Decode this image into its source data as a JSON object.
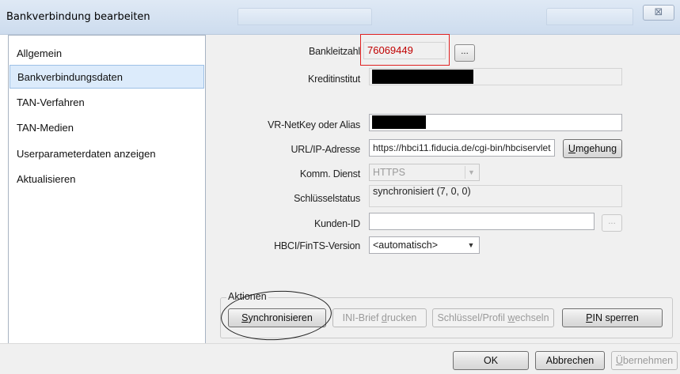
{
  "window": {
    "title": "Bankverbindung bearbeiten",
    "close_symbol": "⊠"
  },
  "sidebar": {
    "items": [
      {
        "label": "Allgemein"
      },
      {
        "label": "Bankverbindungsdaten"
      },
      {
        "label": "TAN-Verfahren"
      },
      {
        "label": "TAN-Medien"
      },
      {
        "label": "Userparameterdaten anzeigen"
      },
      {
        "label": "Aktualisieren"
      }
    ]
  },
  "form": {
    "blz": {
      "label": "Bankleitzahl",
      "value": "76069449",
      "button": "..."
    },
    "kreditinstitut": {
      "label": "Kreditinstitut"
    },
    "netkey": {
      "label": "VR-NetKey oder Alias"
    },
    "url": {
      "label": "URL/IP-Adresse",
      "value": "https://hbci11.fiducia.de/cgi-bin/hbciservlet",
      "button": "Umgehung"
    },
    "komm": {
      "label": "Komm. Dienst",
      "value": "HTTPS"
    },
    "schluessel": {
      "label": "Schlüsselstatus",
      "value": "synchronisiert (7, 0, 0)"
    },
    "kunden": {
      "label": "Kunden-ID",
      "value": "",
      "button": "..."
    },
    "hbci": {
      "label": "HBCI/FinTS-Version",
      "value": "<automatisch>"
    }
  },
  "actions": {
    "group_label": "Aktionen",
    "sync": "Synchronisieren",
    "ini": "INI-Brief drucken",
    "schluessel": "Schlüssel/Profil wechseln",
    "pin": "PIN sperren"
  },
  "footer": {
    "ok": "OK",
    "cancel": "Abbrechen",
    "apply": "Übernehmen"
  },
  "colors": {
    "accent_highlight": "#e02020",
    "blz_text": "#c00000",
    "selection": "#dcebfb"
  }
}
